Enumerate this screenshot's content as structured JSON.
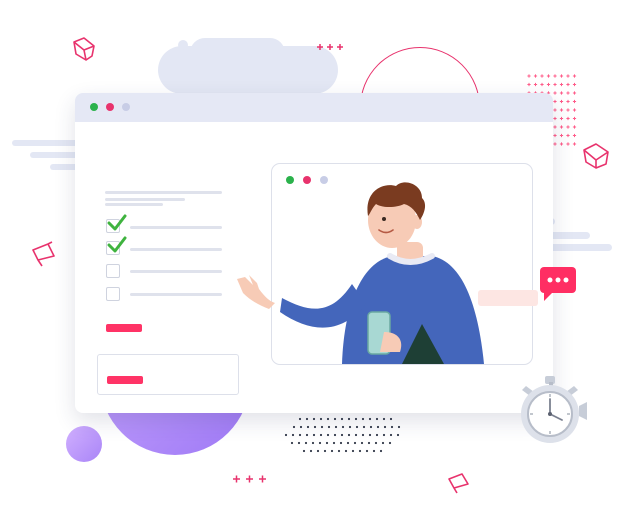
{
  "browser_window": {
    "window_controls": [
      "close",
      "minimize",
      "maximize"
    ],
    "dot_colors": [
      "#2bb24c",
      "#e8336d",
      "#c8cde6"
    ]
  },
  "checklist": {
    "items": [
      {
        "checked": true
      },
      {
        "checked": true
      },
      {
        "checked": false
      },
      {
        "checked": false
      }
    ]
  },
  "video_call": {
    "window_controls": [
      "close",
      "minimize",
      "maximize"
    ]
  },
  "chat_bubble_icon": "speech-bubble-ellipsis-icon",
  "timer_icon": "stopwatch-icon",
  "colors": {
    "accent": "#ff3366",
    "check": "#3fb33f",
    "shirt": "#4466bb",
    "hair": "#7a3b20",
    "skin": "#f7cbb6",
    "cloud": "#e3e7f4",
    "purple": "#b58cff"
  }
}
